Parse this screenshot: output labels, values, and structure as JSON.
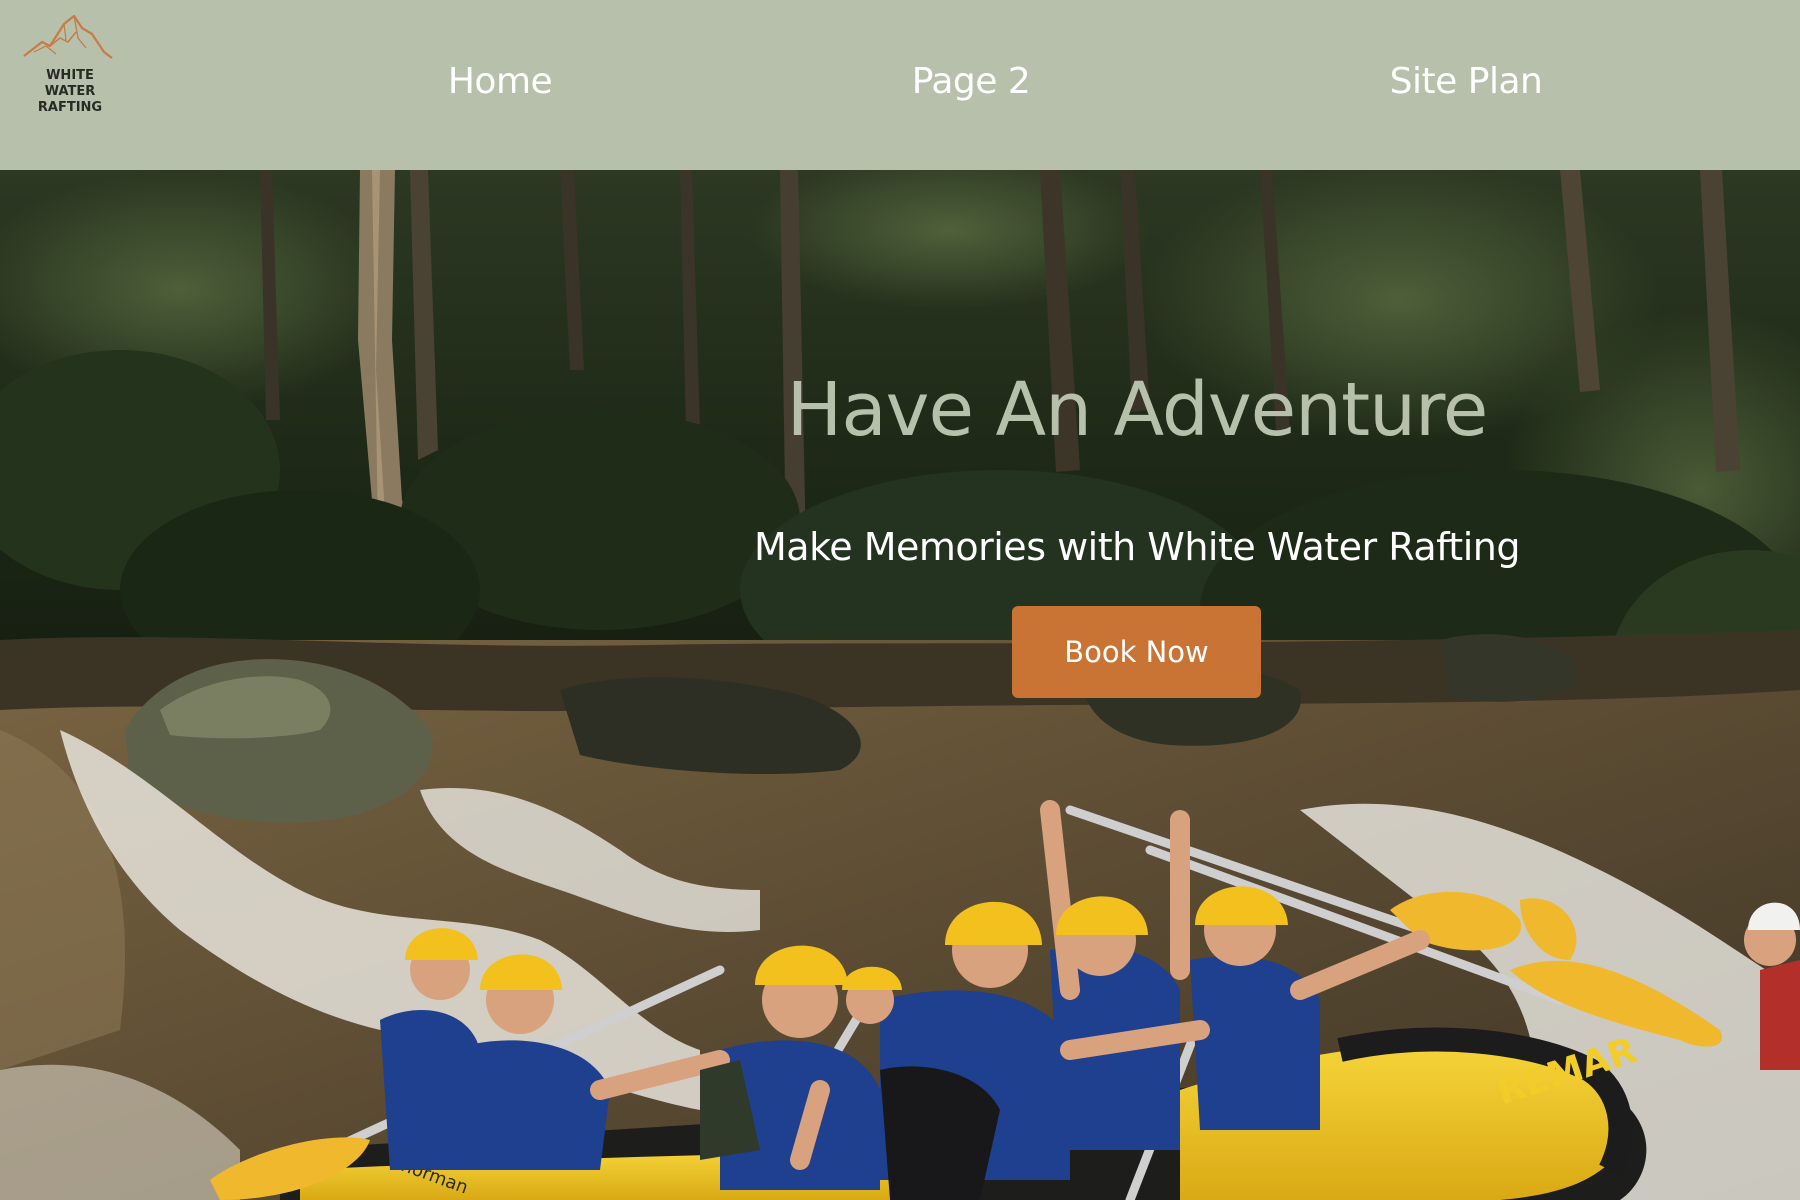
{
  "logo": {
    "line1": "WHITE",
    "line2": "WATER",
    "line3": "RAFTING"
  },
  "nav": {
    "items": [
      {
        "label": "Home"
      },
      {
        "label": "Page 2"
      },
      {
        "label": "Site Plan"
      }
    ]
  },
  "hero": {
    "title": "Have An Adventure",
    "subtitle": "Make Memories with White Water Rafting",
    "cta_label": "Book Now",
    "raft_brand": "REMAR",
    "paddle_brand": "norman"
  },
  "colors": {
    "header_bg": "#b7c0ab",
    "title_color": "#b7c0ab",
    "cta_bg": "#c97434",
    "raft_yellow": "#f2cd2a",
    "helmet_yellow": "#f3c11d",
    "vest_blue": "#1f3f8f"
  }
}
